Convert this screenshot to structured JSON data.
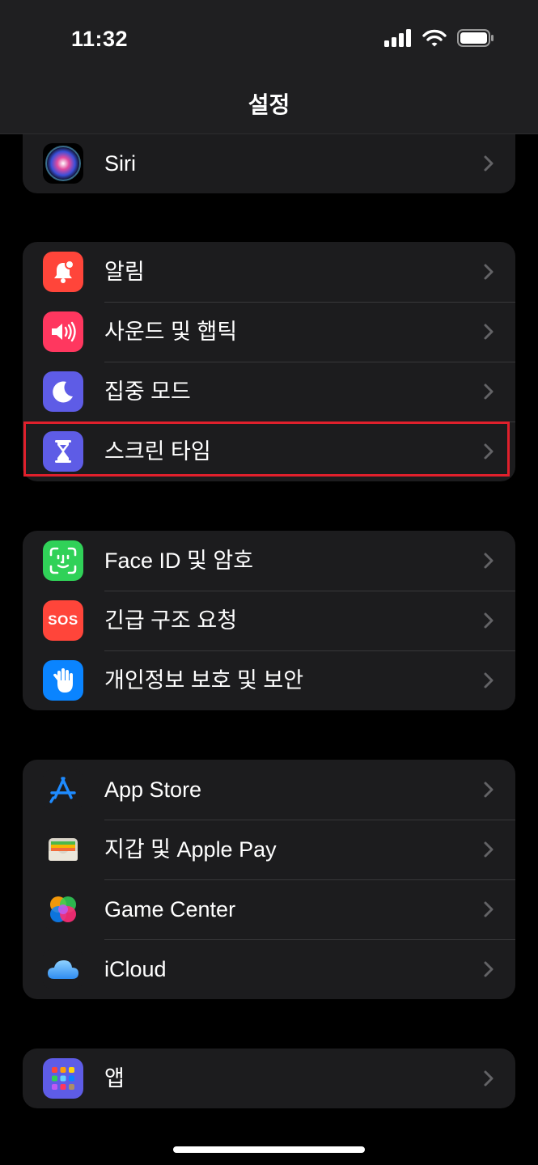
{
  "status_bar": {
    "time": "11:32"
  },
  "nav": {
    "title": "설정"
  },
  "groups": [
    {
      "items": [
        {
          "label": "Siri",
          "icon": "siri-icon"
        }
      ]
    },
    {
      "items": [
        {
          "label": "알림",
          "icon": "bell-icon",
          "color": "#ff453a"
        },
        {
          "label": "사운드 및 햅틱",
          "icon": "speaker-icon",
          "color": "#ff375f"
        },
        {
          "label": "집중 모드",
          "icon": "moon-icon",
          "color": "#5e5ce6"
        },
        {
          "label": "스크린 타임",
          "icon": "hourglass-icon",
          "color": "#5e5ce6",
          "highlighted": true
        }
      ]
    },
    {
      "items": [
        {
          "label": "Face ID 및 암호",
          "icon": "face-id-icon",
          "color": "#30d158"
        },
        {
          "label": "긴급 구조 요청",
          "icon": "sos-icon",
          "color": "#ff453a",
          "icon_text": "SOS"
        },
        {
          "label": "개인정보 보호 및 보안",
          "icon": "hand-icon",
          "color": "#0a84ff"
        }
      ]
    },
    {
      "items": [
        {
          "label": "App Store",
          "icon": "app-store-icon",
          "color": "#1c1c1e"
        },
        {
          "label": "지갑 및 Apple Pay",
          "icon": "wallet-icon",
          "color": "#1c1c1e"
        },
        {
          "label": "Game Center",
          "icon": "game-center-icon",
          "color": "#1c1c1e"
        },
        {
          "label": "iCloud",
          "icon": "icloud-icon",
          "color": "#1c1c1e"
        }
      ]
    },
    {
      "items": [
        {
          "label": "앱",
          "icon": "apps-grid-icon",
          "color": "#5e5ce6"
        }
      ]
    }
  ],
  "colors": {
    "highlight": "#e0202c",
    "background": "#000000",
    "group_background": "#1c1c1e"
  }
}
